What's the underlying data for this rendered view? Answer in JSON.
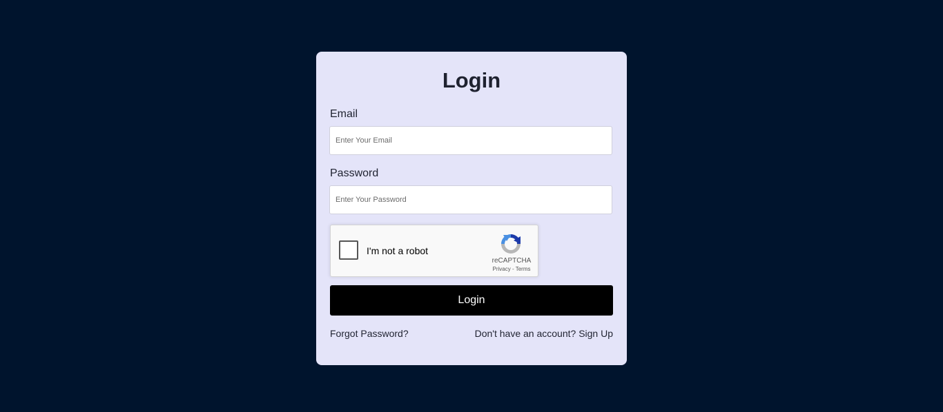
{
  "login": {
    "title": "Login",
    "email": {
      "label": "Email",
      "placeholder": "Enter Your Email",
      "value": ""
    },
    "password": {
      "label": "Password",
      "placeholder": "Enter Your Password",
      "value": ""
    },
    "captcha": {
      "text": "I'm not a robot",
      "brand": "reCAPTCHA",
      "privacy": "Privacy",
      "separator": " - ",
      "terms": "Terms",
      "icon": "recaptcha-logo-icon"
    },
    "submit_label": "Login",
    "forgot_label": "Forgot Password?",
    "no_account_text": "Don't have an account?",
    "signup_label": "Sign Up"
  },
  "colors": {
    "background": "#00142d",
    "card": "#e4e4f9",
    "button": "#000000",
    "text": "#1f2230"
  }
}
